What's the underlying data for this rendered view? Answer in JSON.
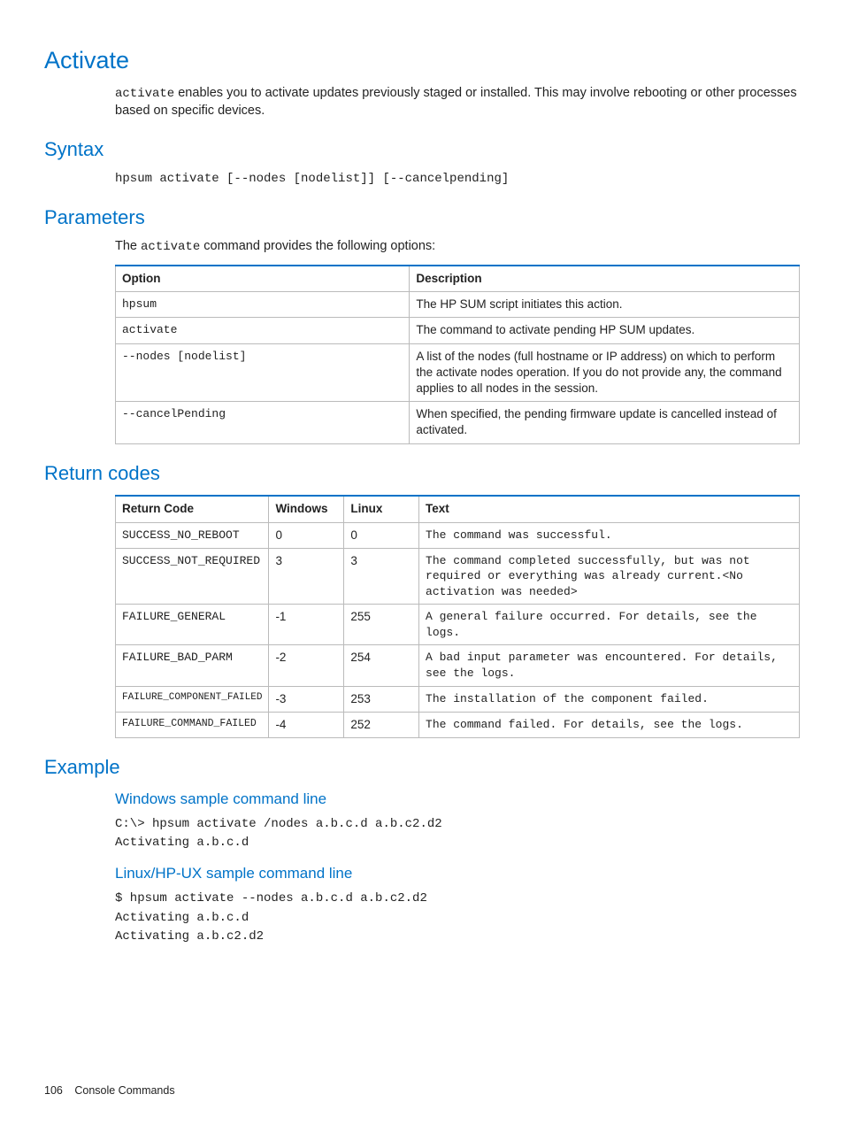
{
  "title": "Activate",
  "intro_pre": "activate",
  "intro_post": " enables you to activate updates previously staged or installed. This may involve rebooting or other processes based on specific devices.",
  "syntax": {
    "heading": "Syntax",
    "code": "hpsum activate [--nodes [nodelist]] [--cancelpending]"
  },
  "params": {
    "heading": "Parameters",
    "intro_pre": "The ",
    "intro_code": "activate",
    "intro_post": " command provides the following options:",
    "headers": {
      "option": "Option",
      "desc": "Description"
    },
    "rows": [
      {
        "option": "hpsum",
        "desc": "The HP SUM script initiates this action."
      },
      {
        "option": "activate",
        "desc": "The command to activate pending HP SUM updates."
      },
      {
        "option": "--nodes [nodelist]",
        "desc": "A list of the nodes (full hostname or IP address) on which to perform the activate nodes operation. If you do not provide any, the command applies to all nodes in the session."
      },
      {
        "option": "--cancelPending",
        "desc": "When specified, the pending firmware update is cancelled instead of activated."
      }
    ]
  },
  "returncodes": {
    "heading": "Return codes",
    "headers": {
      "code": "Return Code",
      "win": "Windows",
      "lin": "Linux",
      "text": "Text"
    },
    "rows": [
      {
        "code": "SUCCESS_NO_REBOOT",
        "win": "0",
        "lin": "0",
        "text": "The command was successful."
      },
      {
        "code": "SUCCESS_NOT_REQUIRED",
        "win": "3",
        "lin": "3",
        "text": "The command completed successfully, but was not required or everything was already current.<No activation was needed>"
      },
      {
        "code": "FAILURE_GENERAL",
        "win": "-1",
        "lin": "255",
        "text": "A general failure occurred. For details, see the logs."
      },
      {
        "code": "FAILURE_BAD_PARM",
        "win": "-2",
        "lin": "254",
        "text": "A bad input parameter was encountered. For details, see the logs."
      },
      {
        "code": "FAILURE_COMPONENT_FAILED",
        "win": "-3",
        "lin": "253",
        "text": "The installation of the component failed."
      },
      {
        "code": "FAILURE_COMMAND_FAILED",
        "win": "-4",
        "lin": "252",
        "text": "The command failed. For details, see the logs."
      }
    ]
  },
  "example": {
    "heading": "Example",
    "win_heading": "Windows sample command line",
    "win_code": "C:\\> hpsum activate /nodes a.b.c.d a.b.c2.d2\nActivating a.b.c.d",
    "lin_heading": "Linux/HP-UX sample command line",
    "lin_code": "$ hpsum activate --nodes a.b.c.d a.b.c2.d2\nActivating a.b.c.d\nActivating a.b.c2.d2"
  },
  "footer": {
    "page": "106",
    "section": "Console Commands"
  }
}
